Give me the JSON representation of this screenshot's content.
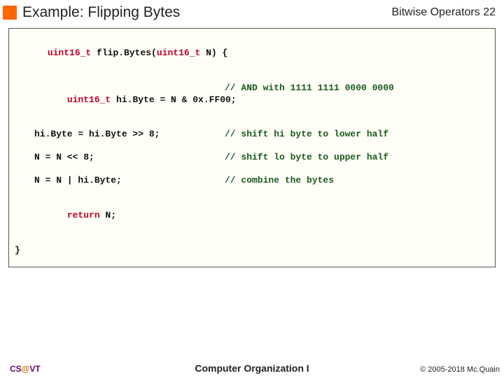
{
  "header": {
    "title": "Example: Flipping Bytes",
    "section": "Bitwise Operators",
    "page": "22"
  },
  "code": {
    "sig_type": "uint16_t",
    "sig_rest": " flip.Bytes(",
    "sig_param_type": "uint16_t",
    "sig_rest2": " N) {",
    "l1_type": "uint16_t",
    "l1_rest": " hi.Byte = N & 0x.FF00;",
    "l1_comment": "// AND with 1111 1111 0000 0000",
    "l2": "hi.Byte = hi.Byte >> 8;",
    "l2_comment": "// shift hi byte to lower half",
    "l3": "N = N << 8;",
    "l3_comment": "// shift lo byte to upper half",
    "l4": "N = N | hi.Byte;",
    "l4_comment": "// combine the bytes",
    "ret_kw": "return",
    "ret_rest": " N;",
    "close": "}"
  },
  "footer": {
    "cs": "CS",
    "at": "@",
    "vt": "VT",
    "center": "Computer Organization I",
    "right": "© 2005-2018 Mc.Quain"
  }
}
